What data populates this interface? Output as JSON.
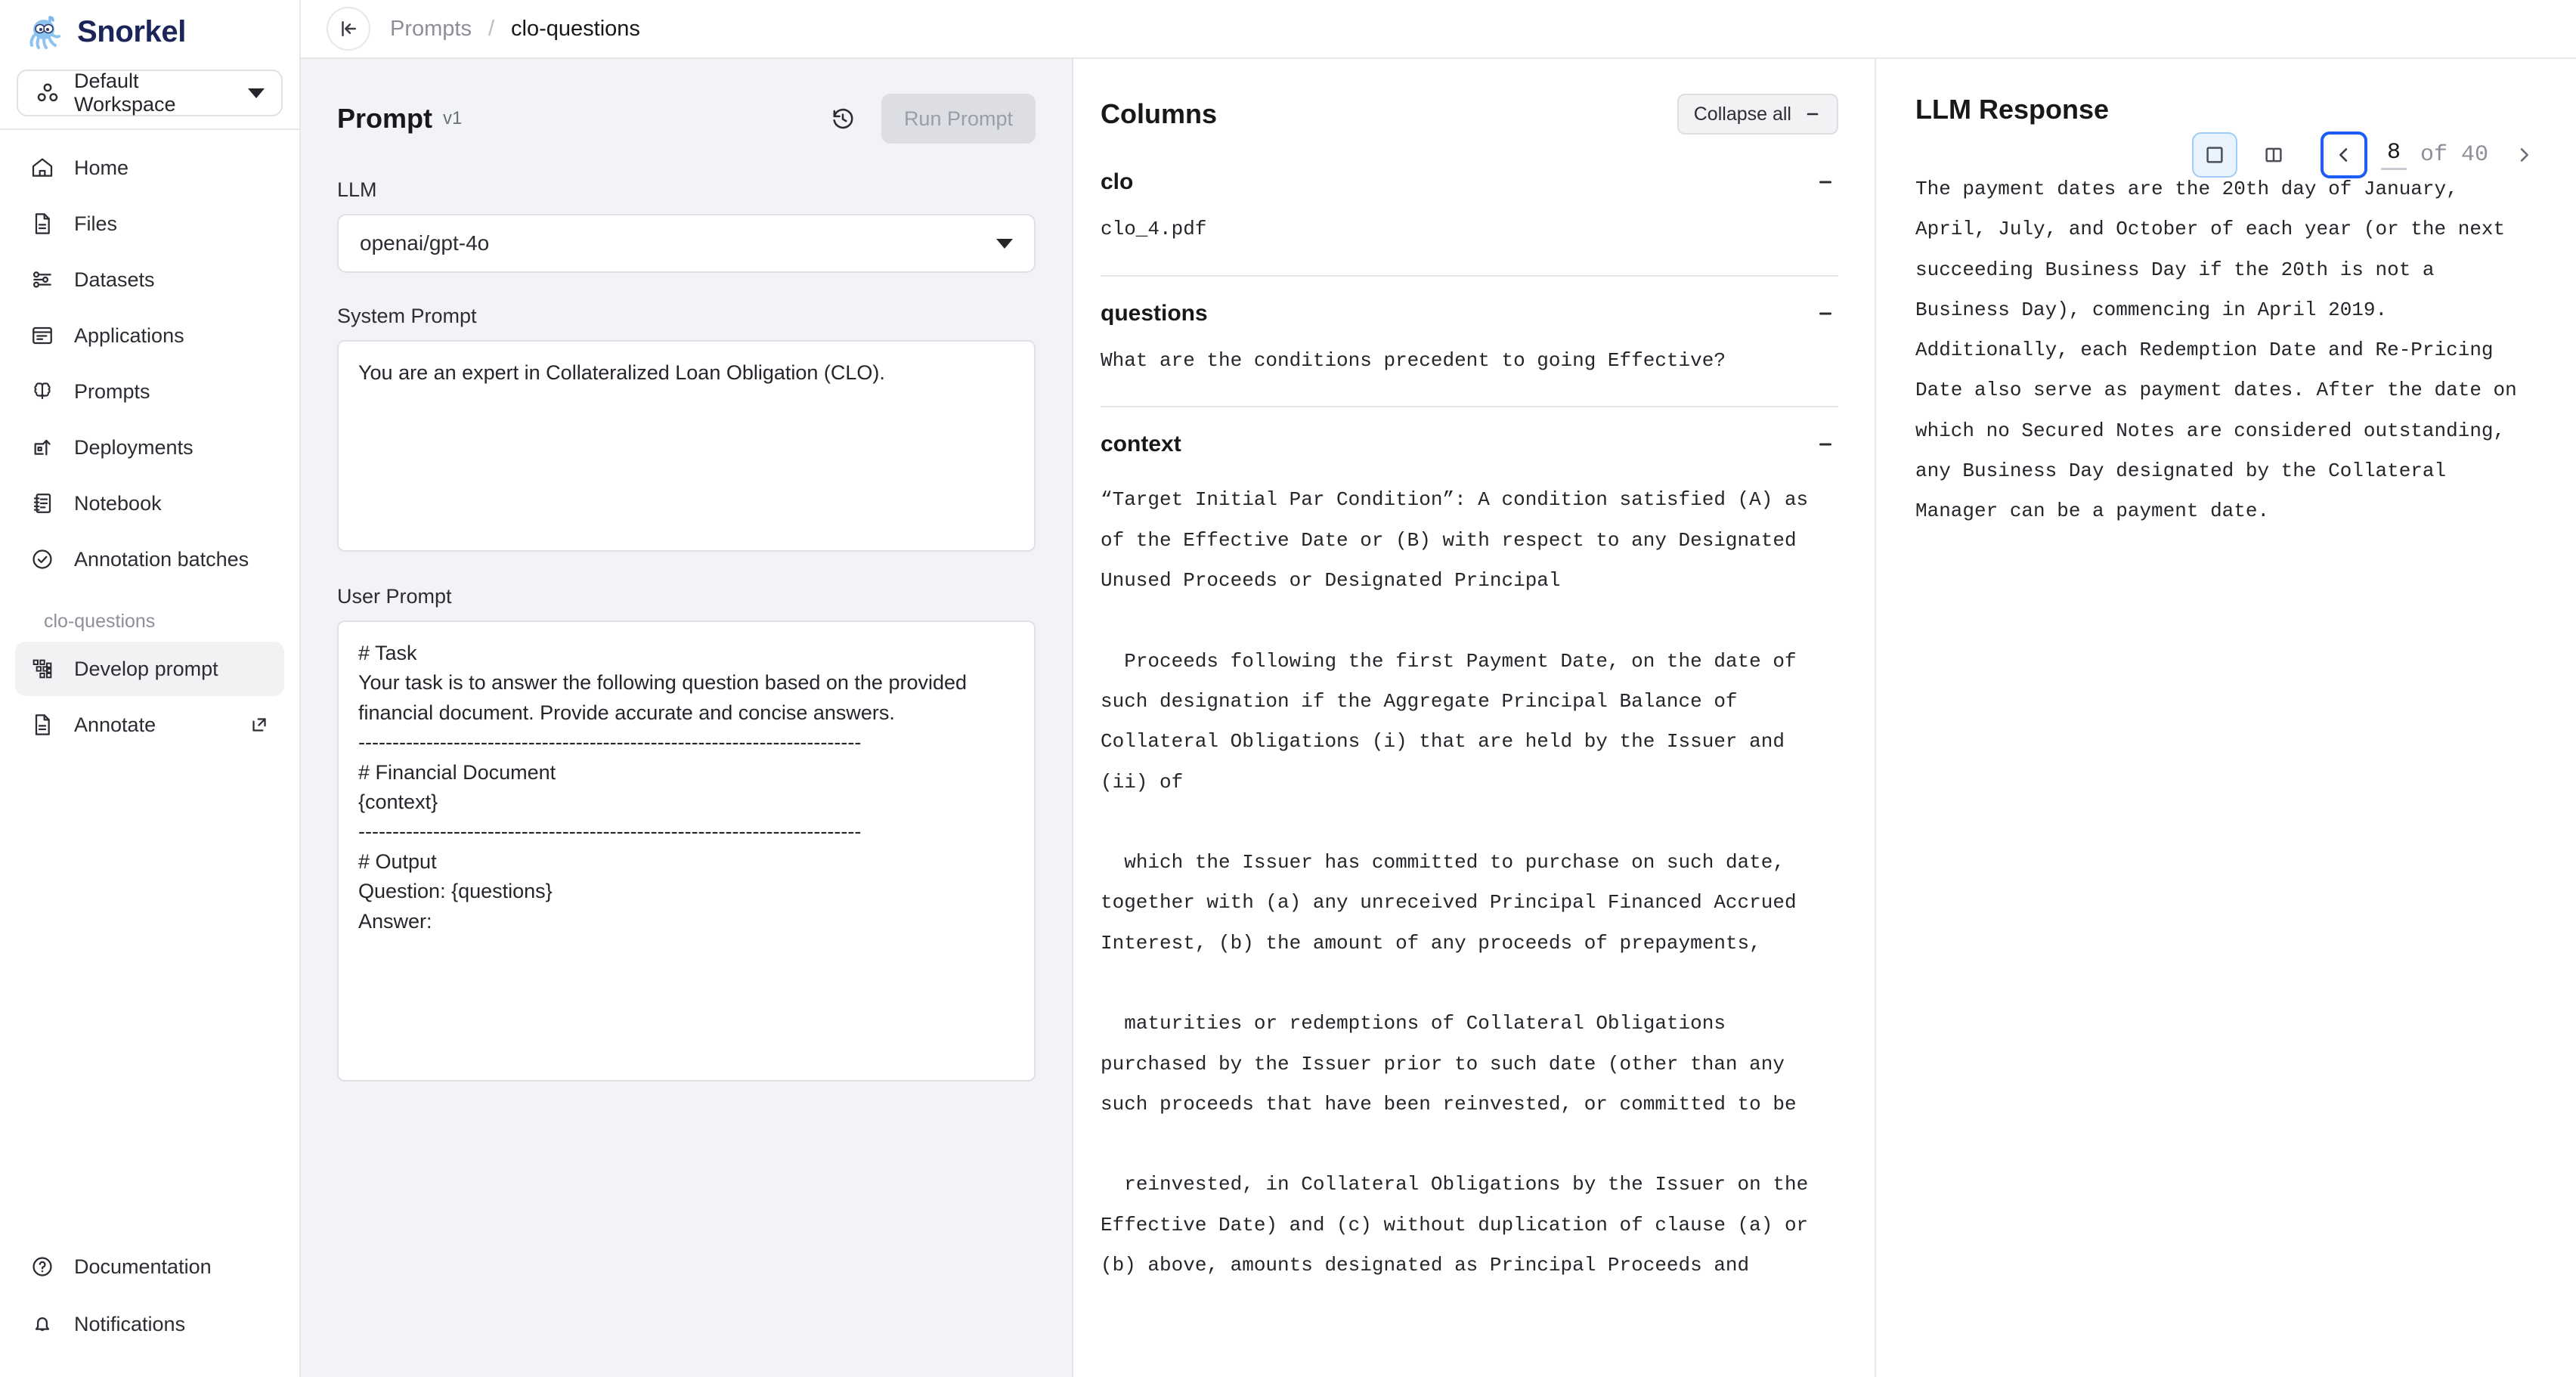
{
  "brand": {
    "name": "Snorkel",
    "logo_icon": "octopus-snorkel-logo"
  },
  "workspace": {
    "label": "Default Workspace",
    "icon": "workspace-dots-icon",
    "caret_icon": "chevron-down-icon"
  },
  "sidebar": {
    "items": [
      {
        "label": "Home",
        "icon": "home-icon"
      },
      {
        "label": "Files",
        "icon": "file-icon"
      },
      {
        "label": "Datasets",
        "icon": "sliders-icon"
      },
      {
        "label": "Applications",
        "icon": "application-panel-icon"
      },
      {
        "label": "Prompts",
        "icon": "brain-icon"
      },
      {
        "label": "Deployments",
        "icon": "deploy-upload-icon"
      },
      {
        "label": "Notebook",
        "icon": "notebook-icon"
      },
      {
        "label": "Annotation batches",
        "icon": "check-circle-icon"
      }
    ],
    "group_title": "clo-questions",
    "group_items": [
      {
        "label": "Develop prompt",
        "icon": "grid-blocks-icon",
        "active": true,
        "external": false
      },
      {
        "label": "Annotate",
        "icon": "file-icon",
        "active": false,
        "external": true
      }
    ],
    "bottom_items": [
      {
        "label": "Documentation",
        "icon": "help-circle-icon"
      },
      {
        "label": "Notifications",
        "icon": "bell-icon"
      }
    ]
  },
  "topbar": {
    "collapse_icon": "collapse-sidebar-icon",
    "breadcrumb": {
      "parent": "Prompts",
      "separator": "/",
      "current": "clo-questions"
    }
  },
  "pager": {
    "single_view_icon": "single-pane-icon",
    "split_view_icon": "split-pane-icon",
    "prev_icon": "chevron-left-icon",
    "next_icon": "chevron-right-icon",
    "current_page": "8",
    "of_label": "of 40"
  },
  "prompt": {
    "title": "Prompt",
    "version": "v1",
    "history_icon": "history-clock-icon",
    "run_label": "Run Prompt",
    "llm_label": "LLM",
    "llm_value": "openai/gpt-4o",
    "system_label": "System Prompt",
    "system_value": "You are an expert in Collateralized Loan Obligation (CLO).",
    "user_label": "User Prompt",
    "user_value": "# Task\nYour task is to answer the following question based on the provided financial document. Provide accurate and concise answers.\n--------------------------------------------------------------------------\n# Financial Document\n{context}\n--------------------------------------------------------------------------\n# Output\nQuestion: {questions}\nAnswer:"
  },
  "columns": {
    "title": "Columns",
    "collapse_all_label": "Collapse all",
    "collapse_all_icon": "minus-icon",
    "sections": [
      {
        "name": "clo",
        "toggle_icon": "minus-icon",
        "value": "clo_4.pdf"
      },
      {
        "name": "questions",
        "toggle_icon": "minus-icon",
        "value": "What are the conditions precedent to going Effective?"
      },
      {
        "name": "context",
        "toggle_icon": "minus-icon",
        "value": "“Target Initial Par Condition”: A condition satisfied (A) as of the Effective Date or (B) with respect to any Designated Unused Proceeds or Designated Principal\n\n  Proceeds following the first Payment Date, on the date of such designation if the Aggregate Principal Balance of Collateral Obligations (i) that are held by the Issuer and (ii) of\n\n  which the Issuer has committed to purchase on such date, together with (a) any unreceived Principal Financed Accrued Interest, (b) the amount of any proceeds of prepayments,\n\n  maturities or redemptions of Collateral Obligations purchased by the Issuer prior to such date (other than any such proceeds that have been reinvested, or committed to be\n\n  reinvested, in Collateral Obligations by the Issuer on the Effective Date) and (c) without duplication of clause (a) or (b) above, amounts designated as Principal Proceeds and"
      }
    ]
  },
  "response": {
    "title": "LLM Response",
    "body": "The payment dates are the 20th day of January, April, July, and October of each year (or the next succeeding Business Day if the 20th is not a Business Day), commencing in April 2019. Additionally, each Redemption Date and Re-Pricing Date also serve as payment dates. After the date on which no Secured Notes are considered outstanding, any Business Day designated by the Collateral Manager can be a payment date."
  },
  "colors": {
    "brand_navy": "#1b2559",
    "accent_blue": "#1c5ef5",
    "toggle_active_bg": "#e8f3fd",
    "panel_bg": "#f2f3f7"
  }
}
